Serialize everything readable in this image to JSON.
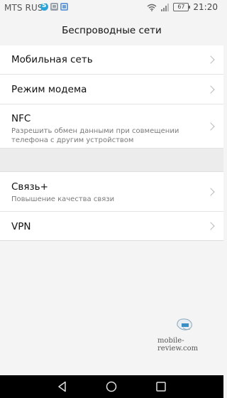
{
  "status_bar": {
    "carrier": "MTS RUS",
    "battery": "67",
    "time": "21:20"
  },
  "header": {
    "title": "Беспроводные сети"
  },
  "settings": {
    "mobile_network": {
      "title": "Мобильная сеть"
    },
    "modem": {
      "title": "Режим модема"
    },
    "nfc": {
      "title": "NFC",
      "subtitle": "Разрешить обмен данными при совмещении телефона с другим устройством"
    },
    "svyaz_plus": {
      "title": "Связь+",
      "subtitle": "Повышение качества связи"
    },
    "vpn": {
      "title": "VPN"
    }
  },
  "watermark": {
    "text": "mobile-review.com"
  },
  "icons": {
    "status": [
      "skype-icon",
      "photo-icon",
      "square-app-icon",
      "wifi-icon",
      "signal-icon",
      "battery-icon"
    ],
    "nav": [
      "back-icon",
      "home-icon",
      "recent-apps-icon"
    ],
    "row": "chevron-right-icon"
  }
}
